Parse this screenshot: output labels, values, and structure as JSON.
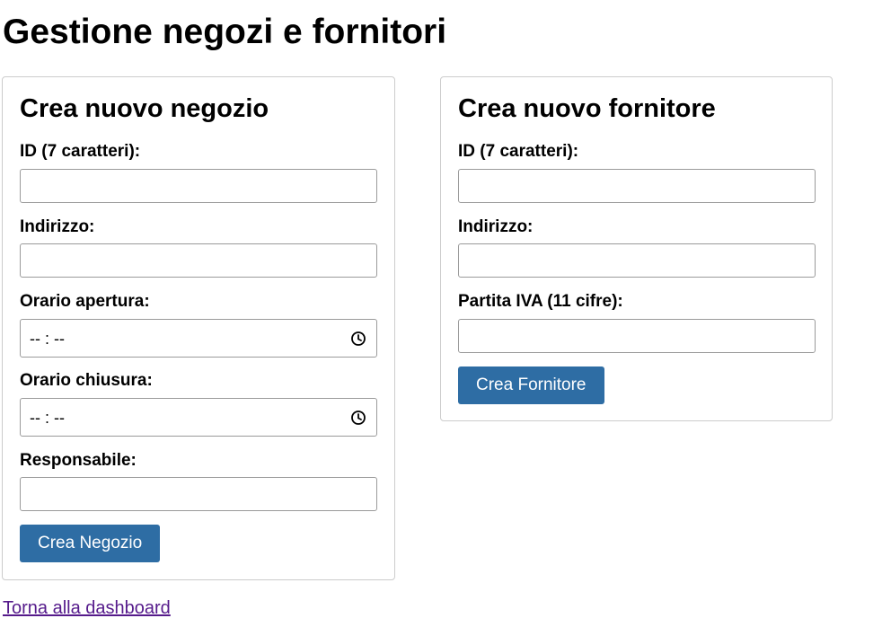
{
  "page": {
    "title": "Gestione negozi e fornitori",
    "back_link": "Torna alla dashboard"
  },
  "negozio_form": {
    "heading": "Crea nuovo negozio",
    "id_label": "ID (7 caratteri):",
    "id_value": "",
    "indirizzo_label": "Indirizzo:",
    "indirizzo_value": "",
    "apertura_label": "Orario apertura:",
    "apertura_placeholder": "-- : --",
    "chiusura_label": "Orario chiusura:",
    "chiusura_placeholder": "-- : --",
    "responsabile_label": "Responsabile:",
    "responsabile_value": "",
    "submit_label": "Crea Negozio"
  },
  "fornitore_form": {
    "heading": "Crea nuovo fornitore",
    "id_label": "ID (7 caratteri):",
    "id_value": "",
    "indirizzo_label": "Indirizzo:",
    "indirizzo_value": "",
    "piva_label": "Partita IVA (11 cifre):",
    "piva_value": "",
    "submit_label": "Crea Fornitore"
  },
  "icons": {
    "time_picker": "clock-icon"
  },
  "colors": {
    "button_bg": "#2e6da4",
    "button_text": "#ffffff",
    "card_border": "#cccccc",
    "visited_link": "#551a8b"
  }
}
